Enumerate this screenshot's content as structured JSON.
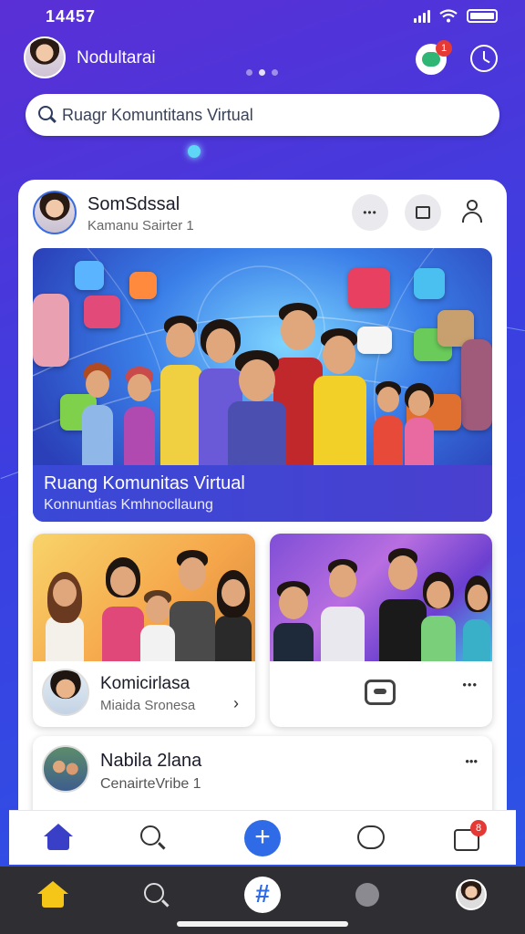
{
  "status_bar": {
    "time": "14457"
  },
  "header": {
    "profile_name": "Nodultarai",
    "chat_badge": "1",
    "search_placeholder": "Ruagr Komuntitans Virtual"
  },
  "post": {
    "author": "SomSdssal",
    "subtitle": "Kamanu Sairter 1",
    "more_label": "•••",
    "hero_title": "Ruang Komunitas Virtual",
    "hero_subtitle": "Konnuntias Kmhnocllaung"
  },
  "cards": [
    {
      "name": "Komicirlasa",
      "subtitle": "Miaida Sronesa",
      "chevron": "›"
    },
    {
      "more_label": "•••"
    }
  ],
  "post2": {
    "name": "Nabila 2lana",
    "subtitle": "CenairteVribe 1",
    "more_label": "•••"
  },
  "inner_nav": {
    "add_label": "+",
    "notify_badge": "8"
  },
  "system_bar": {
    "add_label": "#"
  },
  "colors": {
    "background_start": "#5a2fd6",
    "background_end": "#2a55e6",
    "accent_blue": "#2f6be6",
    "home_active": "#3a3fc8",
    "home_system": "#f5c518",
    "badge_red": "#e53935"
  },
  "icons": [
    "search-icon",
    "chat-icon",
    "clock-icon",
    "more-icon",
    "share-icon",
    "user-icon",
    "home-icon",
    "add-icon",
    "notification-icon",
    "message-icon",
    "explore-icon"
  ]
}
